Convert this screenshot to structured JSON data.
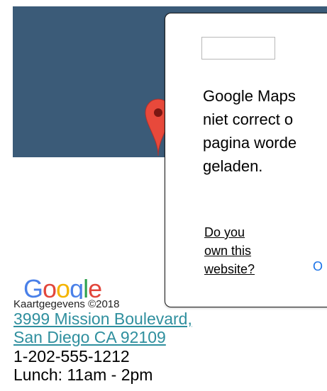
{
  "map": {
    "background_color": "#3b5b78",
    "marker": "map-pin-icon",
    "marker_color": "#e8493b",
    "logo": "google-logo",
    "logo_text": "Google",
    "data_credit": "Kaartgegevens ©2018"
  },
  "error_dialog": {
    "image": "broken-image-placeholder",
    "message_lines": [
      "Google Maps",
      "niet correct o",
      "pagina worde",
      "geladen."
    ],
    "own_site_link_lines": [
      "Do you",
      "own this",
      "website?"
    ],
    "ok_label": "O",
    "ok_color": "#1a73e8"
  },
  "location": {
    "address_line1": "3999 Mission Boulevard,",
    "address_line2": "San Diego CA 92109",
    "phone": "1-202-555-1212",
    "hours": "Lunch: 11am - 2pm",
    "link_color": "#2f8f9e"
  }
}
